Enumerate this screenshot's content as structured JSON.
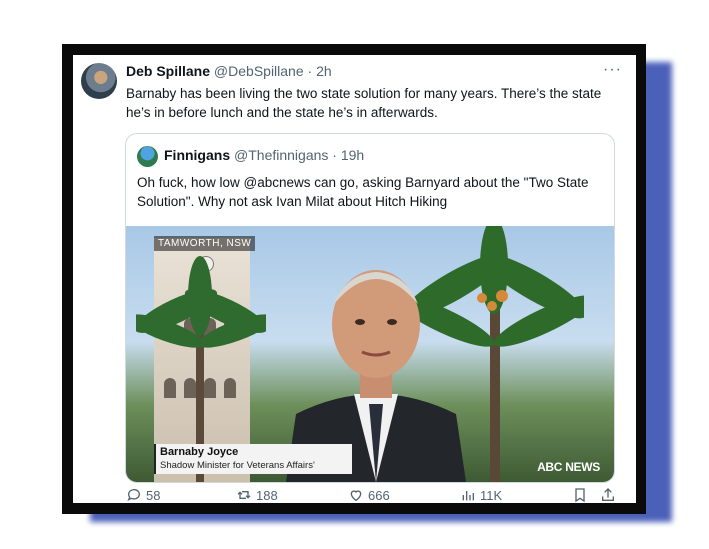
{
  "tweet": {
    "author_name": "Deb Spillane",
    "author_handle": "@DebSpillane",
    "time": "· 2h",
    "more_label": "···",
    "text": "Barnaby has been living the two state solution for many years. There’s the state he’s in before lunch and the state he’s in afterwards."
  },
  "quoted": {
    "author_name": "Finnigans",
    "author_handle": "@Thefinnigans",
    "time": "· 19h",
    "text": "Oh fuck, how low @abcnews can go, asking Barnyard about the \"Two State Solution\". Why not ask Ivan Milat about Hitch Hiking",
    "media": {
      "location": "TAMWORTH, NSW",
      "lower_third_name": "Barnaby Joyce",
      "lower_third_title": "Shadow Minister for Veterans Affairs'",
      "network_badge": "ABC NEWS"
    }
  },
  "actions": {
    "replies": "58",
    "retweets": "188",
    "likes": "666",
    "views": "11K"
  },
  "colors": {
    "frame": "#0a0a0a",
    "shadow": "#4b61b9",
    "text": "#0f1419",
    "muted": "#536471"
  }
}
